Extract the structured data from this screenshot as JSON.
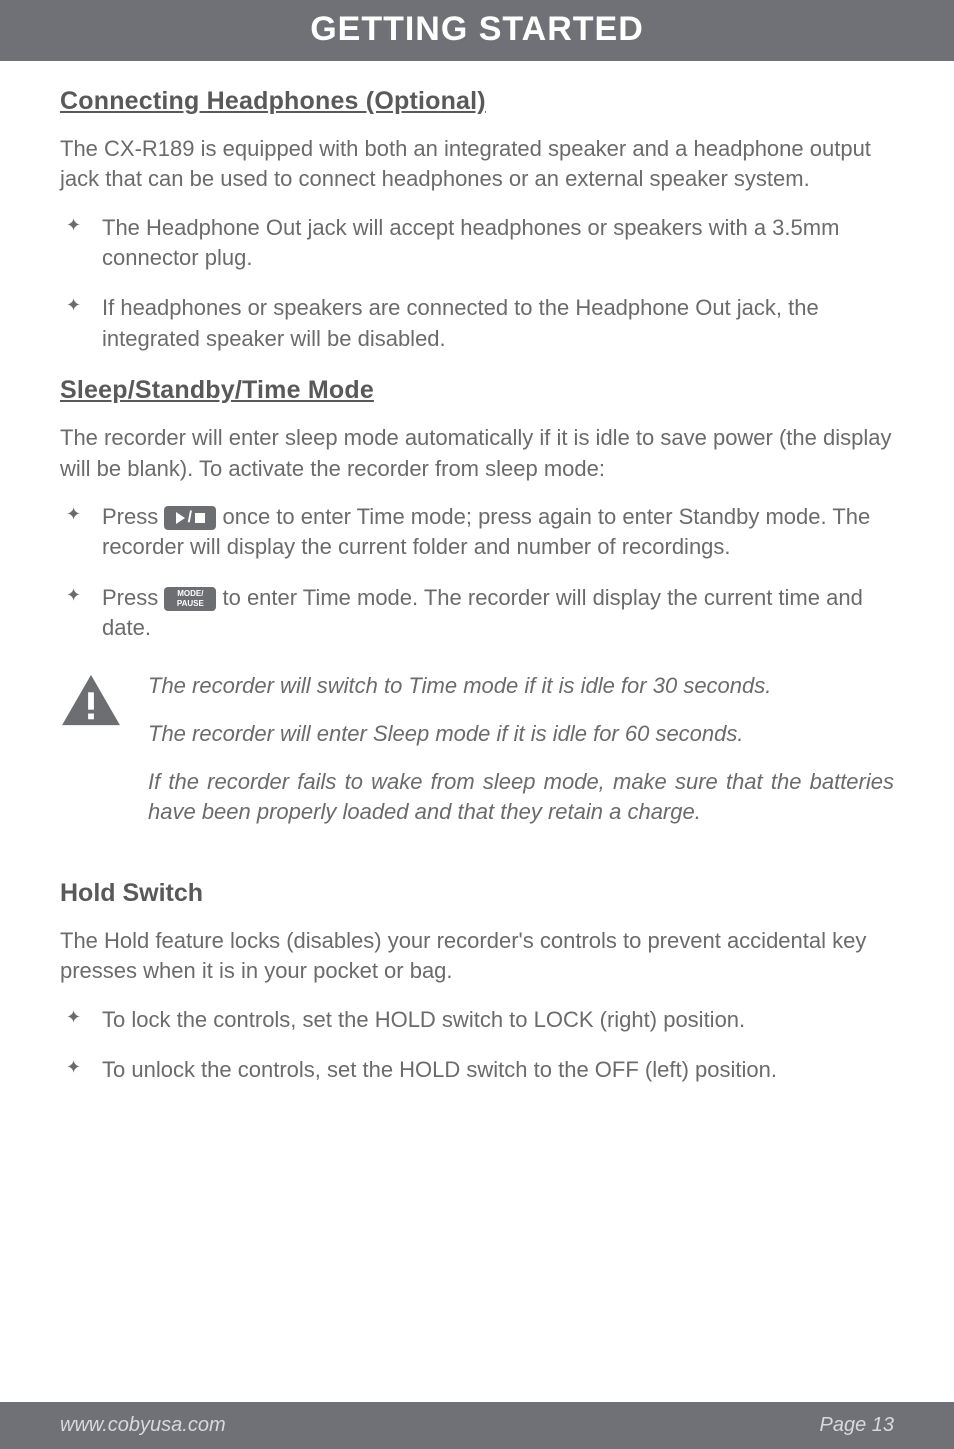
{
  "header": {
    "title": "GETTING STARTED"
  },
  "sections": {
    "headphones": {
      "title": "Connecting Headphones (Optional)",
      "intro": "The CX-R189 is equipped with both an integrated speaker and a headphone output jack that can be used to connect headphones or an external speaker system.",
      "bullets": [
        "The Headphone Out jack will accept headphones or speakers with a 3.5mm connector plug.",
        "If headphones or speakers are connected to the Headphone Out jack, the integrated speaker will be disabled."
      ]
    },
    "sleep": {
      "title": "Sleep/Standby/Time Mode",
      "intro": "The recorder will enter sleep mode automatically if it is idle to save power (the display will be blank). To activate the recorder from sleep mode:",
      "bullet1_pre": "Press ",
      "bullet1_post": " once to enter Time mode; press again to enter Standby mode. The recorder will display the current folder and number of recordings.",
      "bullet2_pre": "Press ",
      "bullet2_post": " to enter Time mode. The recorder will display the current time and date.",
      "mode_label_top": "MODE/",
      "mode_label_bottom": "PAUSE",
      "notes": [
        "The recorder will switch to Time mode if it is idle for 30 seconds.",
        "The recorder will enter Sleep mode if it is idle for 60 seconds.",
        "If the recorder fails to wake from sleep mode, make sure that the batteries have been properly loaded and that they retain a charge."
      ]
    },
    "hold": {
      "title": "Hold Switch",
      "intro": "The Hold feature locks (disables) your recorder's controls to prevent accidental key presses when it is in your pocket or bag.",
      "bullets": [
        "To lock the controls, set the HOLD switch to LOCK (right) position.",
        "To unlock the controls, set the HOLD switch to the OFF (left) position."
      ]
    }
  },
  "footer": {
    "url": "www.cobyusa.com",
    "page": "Page 13"
  }
}
